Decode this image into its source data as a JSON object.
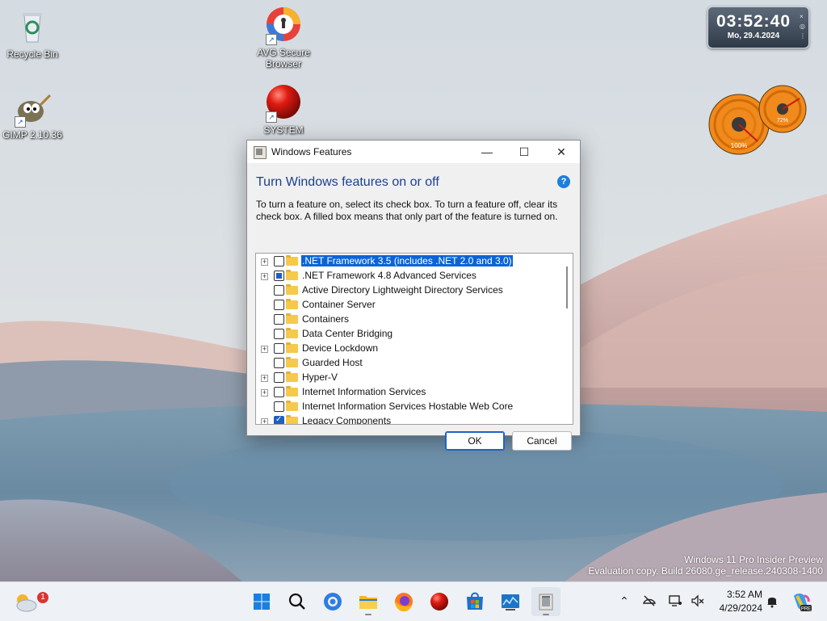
{
  "desktop": {
    "icons": [
      {
        "label": "Recycle Bin"
      },
      {
        "label": "AVG Secure Browser"
      },
      {
        "label": "GIMP 2.10.36"
      },
      {
        "label": "SYSTEM"
      }
    ],
    "clock_gadget": {
      "time": "03:52:40",
      "date": "Mo, 29.4.2024"
    },
    "meters": [
      {
        "value": "100%"
      },
      {
        "value": "72%"
      }
    ]
  },
  "dialog": {
    "title": "Windows Features",
    "heading": "Turn Windows features on or off",
    "description": "To turn a feature on, select its check box. To turn a feature off, clear its check box. A filled box means that only part of the feature is turned on.",
    "features": [
      {
        "label": ".NET Framework 3.5 (includes .NET 2.0 and 3.0)",
        "expandable": true,
        "state": "unchecked",
        "selected": true
      },
      {
        "label": ".NET Framework 4.8 Advanced Services",
        "expandable": true,
        "state": "partial",
        "selected": false
      },
      {
        "label": "Active Directory Lightweight Directory Services",
        "expandable": false,
        "state": "unchecked",
        "selected": false
      },
      {
        "label": "Container Server",
        "expandable": false,
        "state": "unchecked",
        "selected": false
      },
      {
        "label": "Containers",
        "expandable": false,
        "state": "unchecked",
        "selected": false
      },
      {
        "label": "Data Center Bridging",
        "expandable": false,
        "state": "unchecked",
        "selected": false
      },
      {
        "label": "Device Lockdown",
        "expandable": true,
        "state": "unchecked",
        "selected": false
      },
      {
        "label": "Guarded Host",
        "expandable": false,
        "state": "unchecked",
        "selected": false
      },
      {
        "label": "Hyper-V",
        "expandable": true,
        "state": "unchecked",
        "selected": false
      },
      {
        "label": "Internet Information Services",
        "expandable": true,
        "state": "unchecked",
        "selected": false
      },
      {
        "label": "Internet Information Services Hostable Web Core",
        "expandable": false,
        "state": "unchecked",
        "selected": false
      },
      {
        "label": "Legacy Components",
        "expandable": true,
        "state": "checked",
        "selected": false
      }
    ],
    "ok_label": "OK",
    "cancel_label": "Cancel"
  },
  "watermark": {
    "line1": "Windows 11 Pro Insider Preview",
    "line2": "Evaluation copy. Build 26080.ge_release.240308-1400"
  },
  "taskbar": {
    "weather_badge": "1",
    "time": "3:52 AM",
    "date": "4/29/2024",
    "apps": [
      "start-icon",
      "search-icon",
      "browser-icon",
      "file-explorer-icon",
      "firefox-icon",
      "red-ball-icon",
      "store-icon",
      "monitor-app-icon",
      "windows-features-icon"
    ]
  },
  "colors": {
    "accent": "#0a64d8",
    "heading": "#1c3f94",
    "folder": "#f5c94b"
  }
}
